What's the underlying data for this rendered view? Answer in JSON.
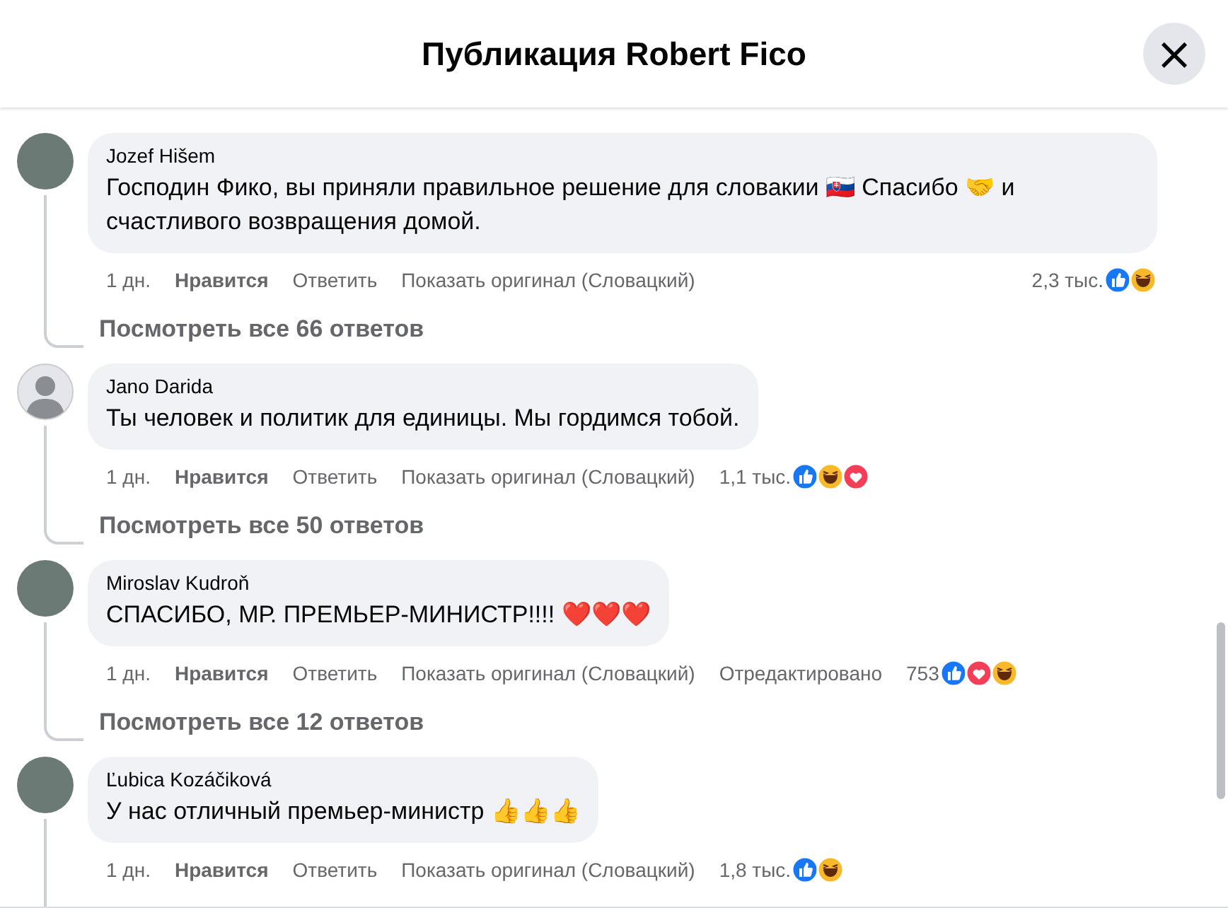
{
  "header": {
    "title": "Публикация Robert Fico",
    "close": "×"
  },
  "comments": [
    {
      "author": "Jozef Hišem",
      "avatar": {
        "kind": "photo"
      },
      "text": "Господин Фико, вы приняли правильное решение для словакии 🇸🇰 Спасибо 🤝 и счастливого возвращения домой.",
      "time": "1 дн.",
      "like": "Нравится",
      "reply": "Ответить",
      "translate": "Показать оригинал (Словацкий)",
      "reaction_count": "2,3 тыс.",
      "reactions": [
        {
          "kind": "like"
        },
        {
          "kind": "haha"
        }
      ],
      "replies_link": "Посмотреть все 66 ответов"
    },
    {
      "author": "Jano Darida",
      "avatar": {
        "kind": "default"
      },
      "text": "Ты человек и политик для единицы. Мы гордимся тобой.",
      "time": "1 дн.",
      "like": "Нравится",
      "reply": "Ответить",
      "translate": "Показать оригинал (Словацкий)",
      "reaction_count": "1,1 тыс.",
      "reactions": [
        {
          "kind": "like"
        },
        {
          "kind": "haha"
        },
        {
          "kind": "love"
        }
      ],
      "replies_link": "Посмотреть все 50 ответов"
    },
    {
      "author": "Miroslav Kudroň",
      "avatar": {
        "kind": "photo"
      },
      "text": "СПАСИБО, МР. ПРЕМЬЕР-МИНИСТР!!!! ❤️❤️❤️",
      "time": "1 дн.",
      "like": "Нравится",
      "reply": "Ответить",
      "translate": "Показать оригинал (Словацкий)",
      "edited": "Отредактировано",
      "reaction_count": "753",
      "reactions": [
        {
          "kind": "like"
        },
        {
          "kind": "love"
        },
        {
          "kind": "haha"
        }
      ],
      "replies_link": "Посмотреть все 12 ответов"
    },
    {
      "author": "Ľubica Kozáčiková",
      "avatar": {
        "kind": "photo"
      },
      "text": "У нас отличный премьер-министр 👍👍👍",
      "time": "1 дн.",
      "like": "Нравится",
      "reply": "Ответить",
      "translate": "Показать оригинал (Словацкий)",
      "reaction_count": "1,8 тыс.",
      "reactions": [
        {
          "kind": "like"
        },
        {
          "kind": "haha"
        }
      ]
    }
  ]
}
